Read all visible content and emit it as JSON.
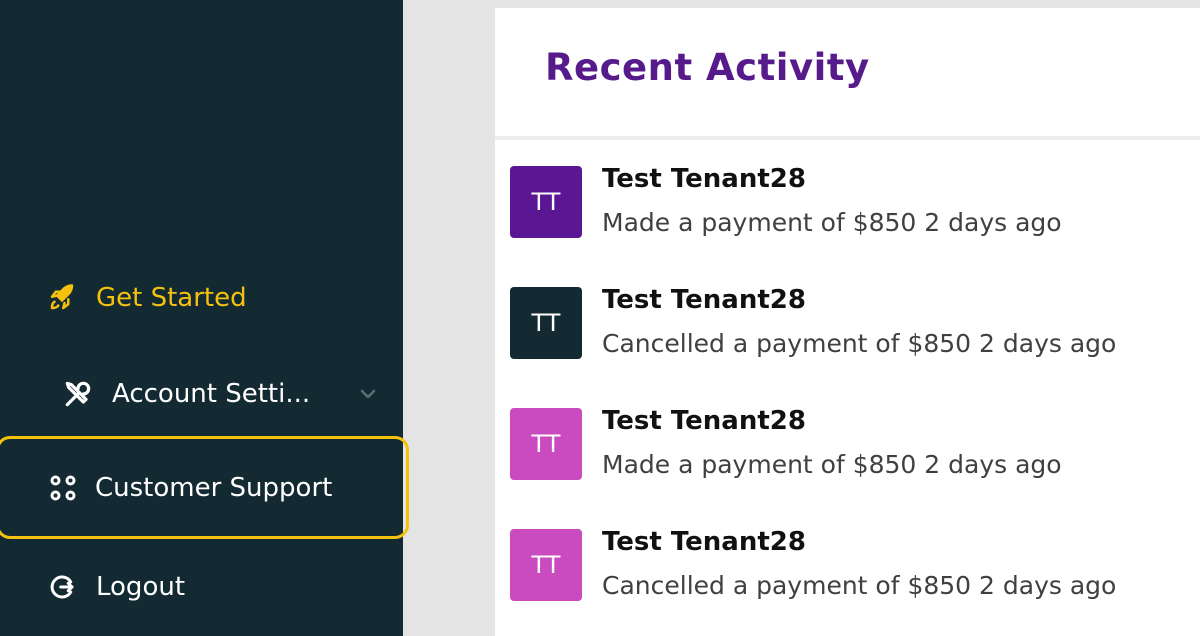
{
  "sidebar": {
    "items": [
      {
        "label": "Get Started",
        "icon": "rocket-icon"
      },
      {
        "label": "Account Setti...",
        "icon": "tools-icon",
        "chevron": "chevron-down-icon"
      },
      {
        "label": "Customer Support",
        "icon": "support-icon"
      },
      {
        "label": "Logout",
        "icon": "logout-icon"
      }
    ]
  },
  "main": {
    "title": "Recent Activity",
    "activities": [
      {
        "initials": "TT",
        "name": "Test Tenant28",
        "description": "Made a payment of $850 2 days ago",
        "avatar_color": "#5b1693"
      },
      {
        "initials": "TT",
        "name": "Test Tenant28",
        "description": "Cancelled a payment of $850 2 days ago",
        "avatar_color": "#132a32"
      },
      {
        "initials": "TT",
        "name": "Test Tenant28",
        "description": "Made a payment of $850 2 days ago",
        "avatar_color": "#c94bbf"
      },
      {
        "initials": "TT",
        "name": "Test Tenant28",
        "description": "Cancelled a payment of $850 2 days ago",
        "avatar_color": "#c94bbf"
      }
    ]
  },
  "colors": {
    "sidebar_bg": "#132a32",
    "accent_yellow": "#f4c20d",
    "title_purple": "#561a8b"
  }
}
